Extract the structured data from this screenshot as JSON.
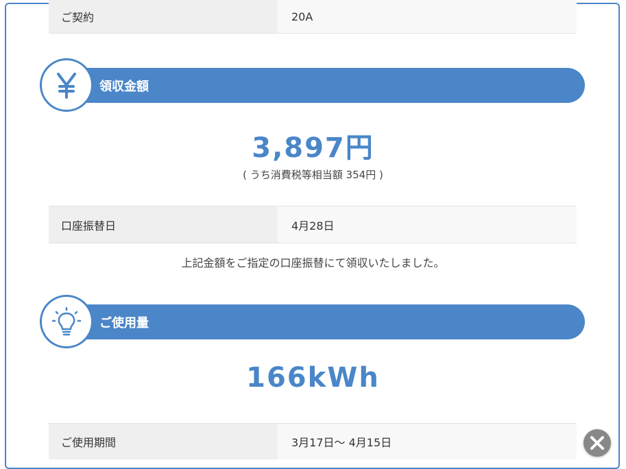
{
  "contract": {
    "label": "ご契約",
    "value": "20A"
  },
  "billing": {
    "title": "領収金額",
    "icon": "yen-icon",
    "amount": "3,897円",
    "tax_note": "( うち消費税等相当額 354円 )",
    "transfer_label": "口座振替日",
    "transfer_date": "4月28日",
    "receipt_note": "上記金額をご指定の口座振替にて領収いたしました。"
  },
  "usage": {
    "title": "ご使用量",
    "icon": "lightbulb-icon",
    "amount": "166kWh",
    "period_label": "ご使用期間",
    "period_value": "3月17日〜 4月15日"
  },
  "close": {
    "icon": "close-icon"
  },
  "colors": {
    "accent": "#4a86c8",
    "close_bg": "#888888"
  }
}
